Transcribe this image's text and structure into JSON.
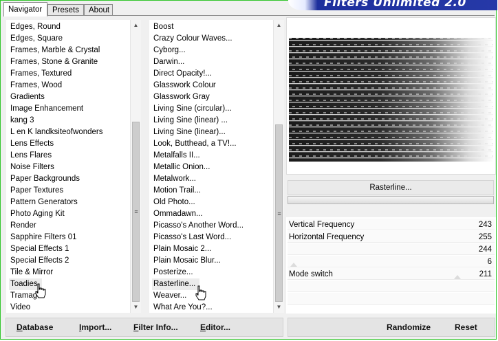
{
  "tabs": [
    {
      "label": "Navigator",
      "active": true
    },
    {
      "label": "Presets",
      "active": false
    },
    {
      "label": "About",
      "active": false
    }
  ],
  "banner_title": "Filters Unlimited 2.0",
  "categories": [
    "Edges, Round",
    "Edges, Square",
    "Frames, Marble & Crystal",
    "Frames, Stone & Granite",
    "Frames, Textured",
    "Frames, Wood",
    "Gradients",
    "Image Enhancement",
    "kang 3",
    "L en K landksiteofwonders",
    "Lens Effects",
    "Lens Flares",
    "Noise Filters",
    "Paper Backgrounds",
    "Paper Textures",
    "Pattern Generators",
    "Photo Aging Kit",
    "Render",
    "Sapphire Filters 01",
    "Special Effects 1",
    "Special Effects 2",
    "Tile & Mirror",
    "Toadies",
    "Tramag",
    "Video"
  ],
  "selected_category": "Toadies",
  "filters": [
    "Boost",
    "Crazy Colour Waves...",
    "Cyborg...",
    "Darwin...",
    "Direct Opacity!...",
    "Glasswork Colour",
    "Glasswork Gray",
    "Living Sine (circular)...",
    "Living Sine (linear) ...",
    "Living Sine (linear)...",
    "Look, Butthead, a TV!...",
    "Metalfalls II...",
    "Metallic Onion...",
    "Metalwork...",
    "Motion Trail...",
    "Old Photo...",
    "Ommadawn...",
    "Picasso's Another Word...",
    "Picasso's Last Word...",
    "Plain Mosaic 2...",
    "Plain Mosaic Blur...",
    "Posterize...",
    "Rasterline...",
    "Weaver...",
    "What Are You?..."
  ],
  "selected_filter": "Rasterline...",
  "filter_name": "Rasterline...",
  "controls": [
    {
      "label": "Vertical Frequency",
      "value": "243",
      "level": 243
    },
    {
      "label": "Horizontal Frequency",
      "value": "255",
      "level": 255
    },
    {
      "label": "",
      "value": "244",
      "level": 244
    },
    {
      "label": "",
      "value": "6",
      "level": 6
    },
    {
      "label": "Mode switch",
      "value": "211",
      "level": 211
    }
  ],
  "buttons_left": [
    {
      "key": "D",
      "rest": "atabase"
    },
    {
      "key": "I",
      "rest": "mport..."
    },
    {
      "key": "F",
      "rest": "ilter Info..."
    },
    {
      "key": "E",
      "rest": "ditor..."
    }
  ],
  "buttons_right": {
    "randomize": "Randomize",
    "reset": "Reset"
  },
  "colors": {
    "frame_border": "#31c52a",
    "banner": "#2639a8"
  }
}
